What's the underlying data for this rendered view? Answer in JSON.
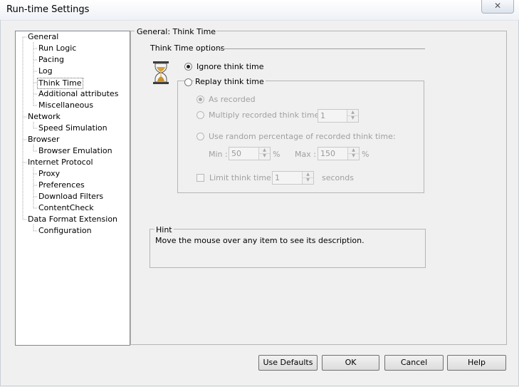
{
  "window": {
    "title": "Run-time Settings",
    "close_glyph": "✕"
  },
  "tree": {
    "items": [
      {
        "label": "General",
        "level": 0
      },
      {
        "label": "Run Logic",
        "level": 1
      },
      {
        "label": "Pacing",
        "level": 1
      },
      {
        "label": "Log",
        "level": 1
      },
      {
        "label": "Think Time",
        "level": 1,
        "selected": true
      },
      {
        "label": "Additional attributes",
        "level": 1
      },
      {
        "label": "Miscellaneous",
        "level": 1
      },
      {
        "label": "Network",
        "level": 0
      },
      {
        "label": "Speed Simulation",
        "level": 1
      },
      {
        "label": "Browser",
        "level": 0
      },
      {
        "label": "Browser Emulation",
        "level": 1
      },
      {
        "label": "Internet Protocol",
        "level": 0
      },
      {
        "label": "Proxy",
        "level": 1
      },
      {
        "label": "Preferences",
        "level": 1
      },
      {
        "label": "Download Filters",
        "level": 1
      },
      {
        "label": "ContentCheck",
        "level": 1
      },
      {
        "label": "Data Format Extension",
        "level": 0
      },
      {
        "label": "Configuration",
        "level": 1
      }
    ]
  },
  "panel": {
    "caption": "General: Think Time",
    "section_label": "Think Time options",
    "icon": "hourglass-icon",
    "ignore_label": "Ignore think time",
    "replay_label": "Replay think time",
    "ignore_checked": true,
    "replay": {
      "as_recorded_label": "As recorded",
      "multiply_label": "Multiply recorded think time by:",
      "multiply_value": "1",
      "random_label": "Use random percentage of recorded think time:",
      "min_label": "Min :",
      "min_value": "50",
      "min_unit": "%",
      "max_label": "Max :",
      "max_value": "150",
      "max_unit": "%",
      "limit_label": "Limit think time to:",
      "limit_value": "1",
      "limit_unit": "seconds"
    },
    "hint": {
      "caption": "Hint",
      "text": "Move the mouse over any item to see its description."
    }
  },
  "buttons": {
    "use_defaults": "Use Defaults",
    "ok": "OK",
    "cancel": "Cancel",
    "help": "Help"
  },
  "colors": {
    "background": "#f0f0f0",
    "tree_background": "#ffffff",
    "disabled_text": "#a0a0a0"
  }
}
